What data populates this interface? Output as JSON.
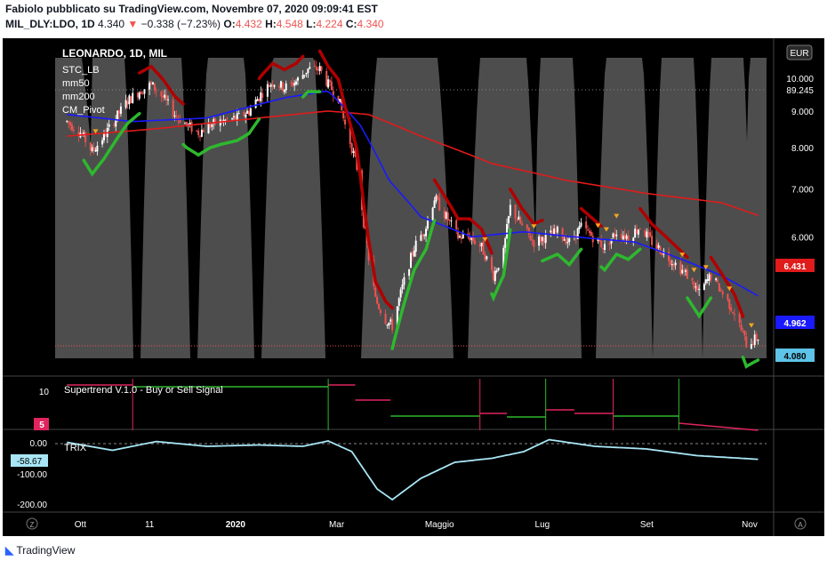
{
  "header": {
    "line1": "Fabiolo pubblicato su TradingView.com, Novembre 07, 2020 09:09:41 EST",
    "symbol": "MIL_DLY:LDO, 1D",
    "last": "4.340",
    "change": "−0.338 (−7.23%)",
    "o_label": "O:",
    "o": "4.432",
    "h_label": "H:",
    "h": "4.548",
    "l_label": "L:",
    "l": "4.224",
    "c_label": "C:",
    "c": "4.340"
  },
  "footer": {
    "brand": "TradingView"
  },
  "colors": {
    "bg": "#000000",
    "up": "#ffffff",
    "down": "#ef5350",
    "mm50": "#1a1aff",
    "mm200": "#e01b1b",
    "stc_up": "#2eb82e",
    "stc_down": "#b00000",
    "stc_area": "#5a5a5a",
    "supertrend_up": "#2eb82e",
    "supertrend_down": "#e0245e",
    "trix": "#a8e6f5"
  },
  "chart_data": [
    {
      "type": "candlestick",
      "title": "LEONARDO, 1D, MIL",
      "legend": [
        "STC_LB",
        "mm50",
        "mm200",
        "CM_Pivot"
      ],
      "currency": "EUR",
      "y_scale": "log",
      "y_ticks": [
        "10.000",
        "9.000",
        "8.000",
        "7.000",
        "6.000"
      ],
      "x_ticks": [
        "Ott",
        "11",
        "2020",
        "Mar",
        "Maggio",
        "Lug",
        "Set",
        "Nov"
      ],
      "price_labels": {
        "top": "89.245",
        "mm200": "6.431",
        "mm50": "4.962",
        "last": "4.080"
      },
      "price_path": [
        [
          "2019-09-23",
          8.7
        ],
        [
          "2019-10-01",
          8.4
        ],
        [
          "2019-10-08",
          7.9
        ],
        [
          "2019-10-15",
          8.3
        ],
        [
          "2019-10-22",
          8.8
        ],
        [
          "2019-10-29",
          9.3
        ],
        [
          "2019-11-05",
          9.6
        ],
        [
          "2019-11-12",
          9.8
        ],
        [
          "2019-11-19",
          9.4
        ],
        [
          "2019-11-26",
          8.9
        ],
        [
          "2019-12-03",
          8.6
        ],
        [
          "2019-12-10",
          8.4
        ],
        [
          "2019-12-17",
          8.6
        ],
        [
          "2019-12-24",
          8.7
        ],
        [
          "2020-01-02",
          8.8
        ],
        [
          "2020-01-09",
          9.0
        ],
        [
          "2020-01-16",
          9.5
        ],
        [
          "2020-01-23",
          9.9
        ],
        [
          "2020-01-30",
          9.7
        ],
        [
          "2020-02-06",
          9.9
        ],
        [
          "2020-02-13",
          10.3
        ],
        [
          "2020-02-20",
          10.3
        ],
        [
          "2020-02-25",
          9.8
        ],
        [
          "2020-03-02",
          9.4
        ],
        [
          "2020-03-06",
          8.6
        ],
        [
          "2020-03-10",
          8.0
        ],
        [
          "2020-03-13",
          7.5
        ],
        [
          "2020-03-17",
          6.3
        ],
        [
          "2020-03-20",
          5.6
        ],
        [
          "2020-03-24",
          4.9
        ],
        [
          "2020-03-30",
          4.6
        ],
        [
          "2020-04-03",
          4.5
        ],
        [
          "2020-04-09",
          5.1
        ],
        [
          "2020-04-16",
          5.8
        ],
        [
          "2020-04-23",
          6.2
        ],
        [
          "2020-04-28",
          6.8
        ],
        [
          "2020-05-05",
          6.4
        ],
        [
          "2020-05-12",
          6.0
        ],
        [
          "2020-05-19",
          6.0
        ],
        [
          "2020-05-26",
          5.8
        ],
        [
          "2020-06-02",
          5.3
        ],
        [
          "2020-06-08",
          5.7
        ],
        [
          "2020-06-12",
          6.6
        ],
        [
          "2020-06-19",
          6.2
        ],
        [
          "2020-06-26",
          5.9
        ],
        [
          "2020-07-03",
          6.0
        ],
        [
          "2020-07-10",
          6.1
        ],
        [
          "2020-07-17",
          5.9
        ],
        [
          "2020-07-24",
          6.2
        ],
        [
          "2020-07-31",
          6.0
        ],
        [
          "2020-08-07",
          5.8
        ],
        [
          "2020-08-14",
          6.1
        ],
        [
          "2020-08-21",
          6.0
        ],
        [
          "2020-08-28",
          6.2
        ],
        [
          "2020-09-04",
          5.9
        ],
        [
          "2020-09-11",
          5.7
        ],
        [
          "2020-09-18",
          5.5
        ],
        [
          "2020-09-25",
          5.3
        ],
        [
          "2020-10-02",
          5.0
        ],
        [
          "2020-10-09",
          5.3
        ],
        [
          "2020-10-16",
          5.0
        ],
        [
          "2020-10-23",
          4.7
        ],
        [
          "2020-10-30",
          4.25
        ],
        [
          "2020-11-06",
          4.34
        ]
      ],
      "mm50": [
        [
          "2019-09-23",
          8.9
        ],
        [
          "2019-11-01",
          8.7
        ],
        [
          "2019-12-15",
          8.8
        ],
        [
          "2020-01-31",
          9.4
        ],
        [
          "2020-02-25",
          9.6
        ],
        [
          "2020-03-15",
          8.6
        ],
        [
          "2020-04-01",
          7.2
        ],
        [
          "2020-04-20",
          6.4
        ],
        [
          "2020-05-20",
          6.0
        ],
        [
          "2020-06-20",
          6.1
        ],
        [
          "2020-07-20",
          6.0
        ],
        [
          "2020-08-25",
          5.9
        ],
        [
          "2020-09-20",
          5.6
        ],
        [
          "2020-10-15",
          5.3
        ],
        [
          "2020-11-06",
          4.96
        ]
      ],
      "mm200": [
        [
          "2019-09-23",
          8.3
        ],
        [
          "2019-11-15",
          8.5
        ],
        [
          "2020-01-15",
          8.8
        ],
        [
          "2020-02-25",
          9.0
        ],
        [
          "2020-03-20",
          8.9
        ],
        [
          "2020-04-20",
          8.3
        ],
        [
          "2020-06-01",
          7.6
        ],
        [
          "2020-07-15",
          7.2
        ],
        [
          "2020-09-01",
          6.9
        ],
        [
          "2020-10-15",
          6.7
        ],
        [
          "2020-11-06",
          6.43
        ]
      ]
    },
    {
      "type": "line",
      "title": "Supertrend V.1.0 - Buy or Sell Signal",
      "y_ticks": [
        "10"
      ],
      "label": "5"
    },
    {
      "type": "line",
      "title": "TRIX",
      "y_ticks": [
        "0.00",
        "-100.00",
        "-200.00"
      ],
      "last_label": "-58.67",
      "trix": [
        [
          "2019-09-23",
          5
        ],
        [
          "2019-10-20",
          -25
        ],
        [
          "2019-11-15",
          8
        ],
        [
          "2019-12-15",
          -10
        ],
        [
          "2020-01-15",
          -5
        ],
        [
          "2020-02-10",
          -10
        ],
        [
          "2020-02-25",
          10
        ],
        [
          "2020-03-10",
          -30
        ],
        [
          "2020-03-25",
          -170
        ],
        [
          "2020-04-03",
          -210
        ],
        [
          "2020-04-20",
          -130
        ],
        [
          "2020-05-10",
          -70
        ],
        [
          "2020-06-01",
          -55
        ],
        [
          "2020-06-20",
          -30
        ],
        [
          "2020-07-05",
          15
        ],
        [
          "2020-08-01",
          -10
        ],
        [
          "2020-09-01",
          -20
        ],
        [
          "2020-10-01",
          -45
        ],
        [
          "2020-11-06",
          -58.67
        ]
      ]
    }
  ]
}
